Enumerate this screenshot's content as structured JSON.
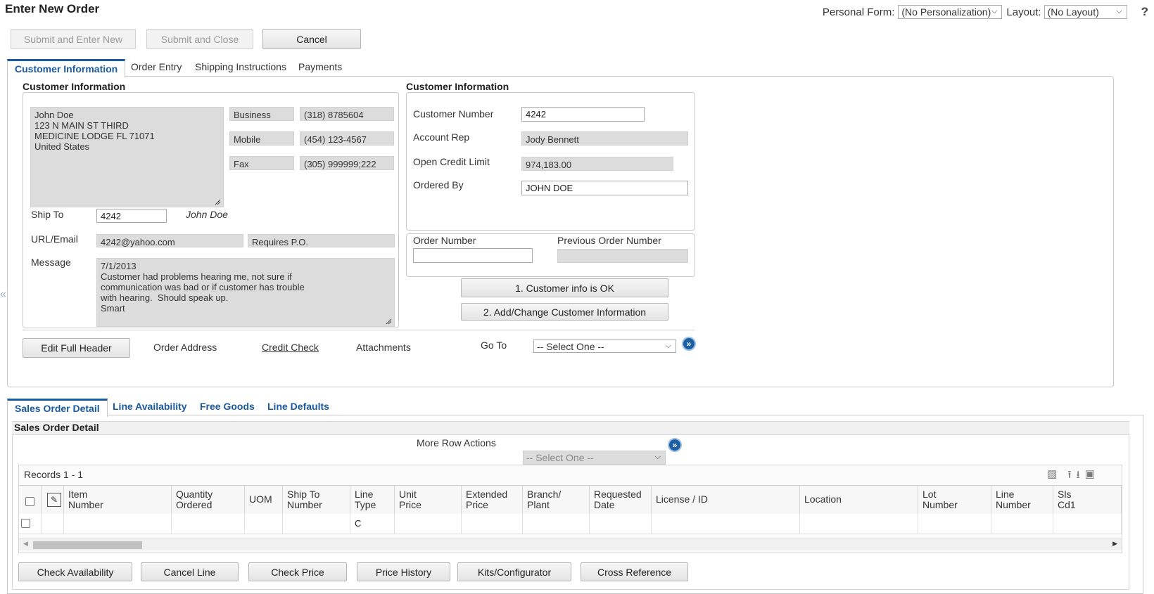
{
  "header": {
    "title": "Enter New Order",
    "personal_form_label": "Personal Form:",
    "personal_form_value": "(No Personalization)",
    "layout_label": "Layout:",
    "layout_value": "(No Layout)",
    "help": "?"
  },
  "toolbar": {
    "submit_new": "Submit and Enter New",
    "submit_close": "Submit and Close",
    "cancel": "Cancel"
  },
  "tabs": [
    "Customer Information",
    "Order Entry",
    "Shipping Instructions",
    "Payments"
  ],
  "left_panel": {
    "title": "Customer Information",
    "address": "John Doe\n123 N MAIN ST THIRD\nMEDICINE LODGE FL 71071\nUnited States",
    "phones": [
      {
        "label": "Business",
        "value": "(318) 8785604"
      },
      {
        "label": "Mobile",
        "value": "(454) 123-4567"
      },
      {
        "label": "Fax",
        "value": "(305) 999999;222"
      }
    ],
    "ship_to_label": "Ship To",
    "ship_to_value": "4242",
    "ship_to_name": "John Doe",
    "url_label": "URL/Email",
    "url_value": "4242@yahoo.com",
    "requires_po": "Requires P.O.",
    "message_label": "Message",
    "message_value": "7/1/2013\nCustomer had problems hearing me, not sure if\ncommunication was bad or if customer has trouble\nwith hearing.  Should speak up.\nSmart"
  },
  "right_panel": {
    "title": "Customer Information",
    "customer_number_label": "Customer Number",
    "customer_number_value": "4242",
    "account_rep_label": "Account Rep",
    "account_rep_value": "Jody Bennett",
    "credit_limit_label": "Open Credit Limit",
    "credit_limit_value": "974,183.00",
    "ordered_by_label": "Ordered By",
    "ordered_by_value": "JOHN DOE",
    "order_number_label": "Order Number",
    "order_number_value": "",
    "prev_order_label": "Previous Order Number",
    "prev_order_value": "",
    "btn_info_ok": "1. Customer info is OK",
    "btn_add_change": "2. Add/Change Customer Information"
  },
  "links": {
    "edit_full_header": "Edit Full Header",
    "order_address": "Order Address",
    "credit_check": "Credit Check",
    "attachments": "Attachments",
    "go_to": "Go To",
    "go_to_value": "-- Select One --"
  },
  "subtabs": [
    "Sales Order Detail",
    "Line Availability",
    "Free Goods",
    "Line Defaults"
  ],
  "detail": {
    "title": "Sales Order Detail",
    "more_row_actions": "More Row Actions",
    "more_row_value": "-- Select One --",
    "records": "Records 1 - 1",
    "columns": [
      "Item\nNumber",
      "Quantity\nOrdered",
      "UOM",
      "Ship To\nNumber",
      "Line\nType",
      "Unit\nPrice",
      "Extended\nPrice",
      "Branch/\nPlant",
      "Requested\nDate",
      "License / ID",
      "Location",
      "Lot\nNumber",
      "Line\nNumber",
      "Sls\nCd1"
    ],
    "row": {
      "line_type": "C"
    }
  },
  "bottom_buttons": [
    "Check Availability",
    "Cancel Line",
    "Check Price",
    "Price History",
    "Kits/Configurator",
    "Cross Reference"
  ],
  "colors": {
    "accent": "#1a5aa0",
    "readonly_bg": "#dcdcdc"
  },
  "icons": [
    "chevron-down-icon",
    "help-icon",
    "go-arrow-icon",
    "resize-handle-icon",
    "collapse-left-icon",
    "grid-tool-icon",
    "export-icon",
    "import-icon",
    "fullscreen-icon",
    "scroll-left-icon",
    "scroll-right-icon"
  ]
}
